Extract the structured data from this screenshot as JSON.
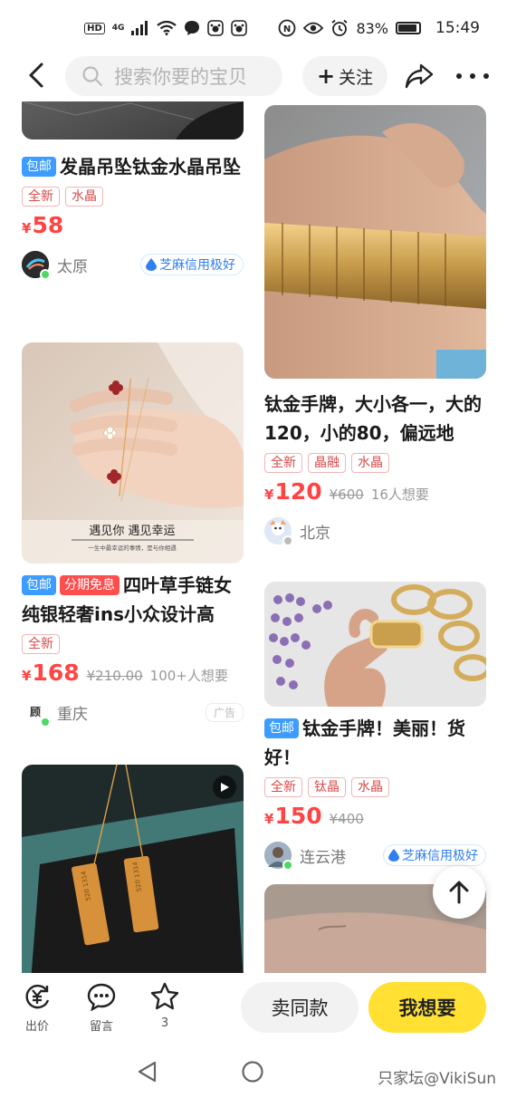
{
  "status_bar": {
    "hd": "HD",
    "network": "4G",
    "battery": "83%",
    "time": "15:49"
  },
  "nav": {
    "search_placeholder": "搜索你要的宝贝",
    "follow_label": "关注"
  },
  "cards": [
    {
      "title": "发晶吊坠钛金水晶吊坠",
      "badges": [
        "包邮"
      ],
      "tags": [
        "全新",
        "水晶"
      ],
      "currency": "¥",
      "price": "58",
      "seller": {
        "city": "太原",
        "credit": "芝麻信用极好"
      }
    },
    {
      "title": "钛金手牌，大小各一，大的120，小的80，偏远地",
      "tags": [
        "全新",
        "晶融",
        "水晶"
      ],
      "currency": "¥",
      "price": "120",
      "old_price": "¥600",
      "wants": "16人想要",
      "seller": {
        "city": "北京"
      }
    },
    {
      "title": "四叶草手链女纯银轻奢ins小众设计高",
      "badges": [
        "包邮",
        "分期免息"
      ],
      "tags": [
        "全新"
      ],
      "currency": "¥",
      "price": "168",
      "old_price": "¥210.00",
      "wants": "100+人想要",
      "image_text": {
        "main": "遇见你  遇见幸运",
        "sub": "一生中最幸运的事情，是与你相遇"
      },
      "seller": {
        "city": "重庆",
        "ad": "广告"
      }
    },
    {
      "title": "钛金手牌！美丽！货好！",
      "badges": [
        "包邮"
      ],
      "tags": [
        "全新",
        "钛晶",
        "水晶"
      ],
      "currency": "¥",
      "price": "150",
      "old_price": "¥400",
      "seller": {
        "city": "连云港",
        "credit": "芝麻信用极好"
      }
    }
  ],
  "bottom_bar": {
    "bid_label": "出价",
    "comment_label": "留言",
    "fav_count": "3",
    "sell_same_label": "卖同款",
    "want_label": "我想要"
  },
  "watermark": "只家坛@VikiSun",
  "colors": {
    "accent_yellow": "#ffe033",
    "price_red": "#ff4444",
    "badge_blue": "#3c9cff",
    "badge_red": "#ff4e4e"
  }
}
